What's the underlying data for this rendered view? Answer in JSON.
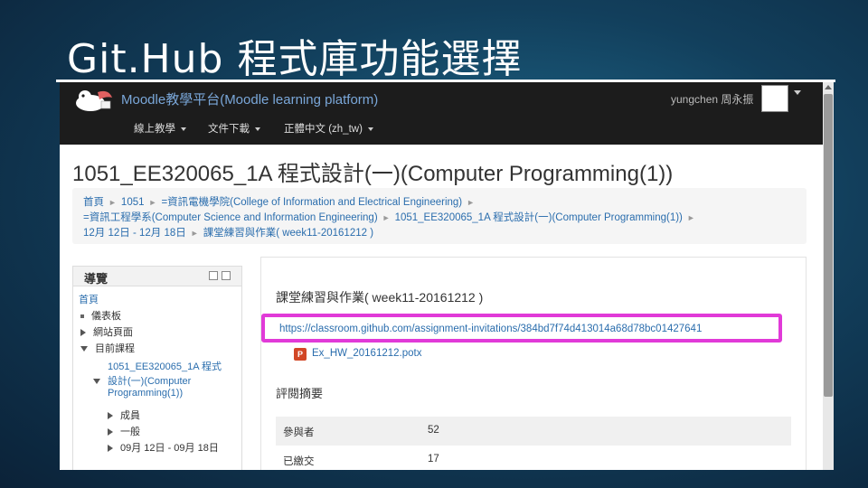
{
  "slide": {
    "title": "Git.Hub 程式庫功能選擇"
  },
  "navbar": {
    "brand": "Moodle教學平台(Moodle learning platform)",
    "user_name": "yungchen 周永振",
    "menu": [
      {
        "label": "線上教學"
      },
      {
        "label": "文件下載"
      },
      {
        "label": "正體中文 (zh_tw)"
      }
    ]
  },
  "course": {
    "title": "1051_EE320065_1A 程式設計(一)(Computer Programming(1))"
  },
  "breadcrumb": {
    "items": [
      "首頁",
      "1051",
      "=資訊電機學院(College of Information and Electrical Engineering)",
      "=資訊工程學系(Computer Science and Information Engineering)",
      "1051_EE320065_1A 程式設計(一)(Computer Programming(1))",
      "12月 12日 - 12月 18日",
      "課堂練習與作業( week11-20161212 )"
    ]
  },
  "nav_block": {
    "title": "導覽",
    "items": [
      {
        "label": "首頁"
      },
      {
        "label": "儀表板"
      },
      {
        "label": "網站頁面"
      },
      {
        "label": "目前課程"
      },
      {
        "label": "1051_EE320065_1A 程式"
      },
      {
        "label": "設計(一)(Computer"
      },
      {
        "label": "Programming(1))"
      },
      {
        "label": "成員"
      },
      {
        "label": "一般"
      },
      {
        "label": "09月 12日 - 09月 18日"
      }
    ]
  },
  "assignment": {
    "title": "課堂練習與作業( week11-20161212 )",
    "link": "https://classroom.github.com/assignment-invitations/384bd7f74d413014a68d78bc01427641",
    "file_name": "Ex_HW_20161212.potx",
    "file_icon": "powerpoint-file-icon",
    "file_icon_glyph": "P",
    "summary_title": "評閱摘要",
    "summary": [
      {
        "label": "參與者",
        "value": "52"
      },
      {
        "label": "已繳交",
        "value": "17"
      }
    ]
  },
  "colors": {
    "highlight": "#e13ad8",
    "link": "#2a6dad",
    "navbar": "#1c1c1c"
  }
}
